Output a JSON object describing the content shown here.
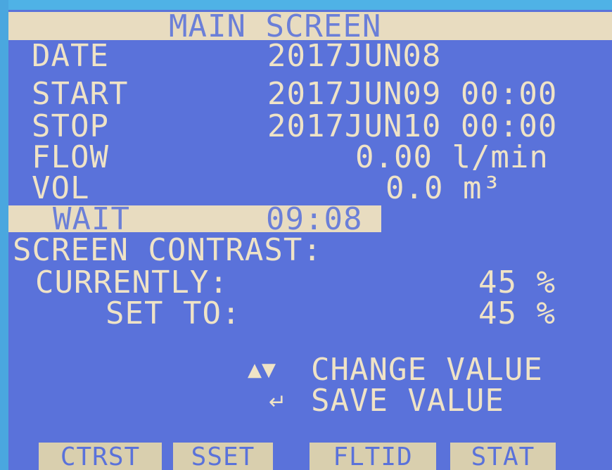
{
  "title": "MAIN SCREEN",
  "rows": {
    "date": {
      "label": "DATE",
      "value": "2017JUN08"
    },
    "start": {
      "label": "START",
      "value": "2017JUN09 00:00"
    },
    "stop": {
      "label": "STOP",
      "value": "2017JUN10 00:00"
    },
    "flow": {
      "label": "FLOW",
      "value": "0.00 l/min"
    },
    "vol": {
      "label": "VOL",
      "value": "0.0 m³"
    }
  },
  "status": {
    "label": "WAIT",
    "value": "09:08"
  },
  "contrast": {
    "heading": "SCREEN CONTRAST:",
    "currently_label": "CURRENTLY:",
    "currently_value": "45 %",
    "setto_label": "SET TO:",
    "setto_value": "45 %"
  },
  "hints": {
    "updown_icon": "up-down-arrows-icon",
    "change_label": "CHANGE VALUE",
    "enter_icon": "enter-arrow-icon",
    "save_label": "SAVE VALUE"
  },
  "softkeys": [
    "CTRST",
    "SSET",
    "FLTID",
    "STAT"
  ],
  "colors": {
    "background": "#5a72da",
    "foreground": "#efe3c6",
    "highlight_band": "#e8dcc0"
  }
}
